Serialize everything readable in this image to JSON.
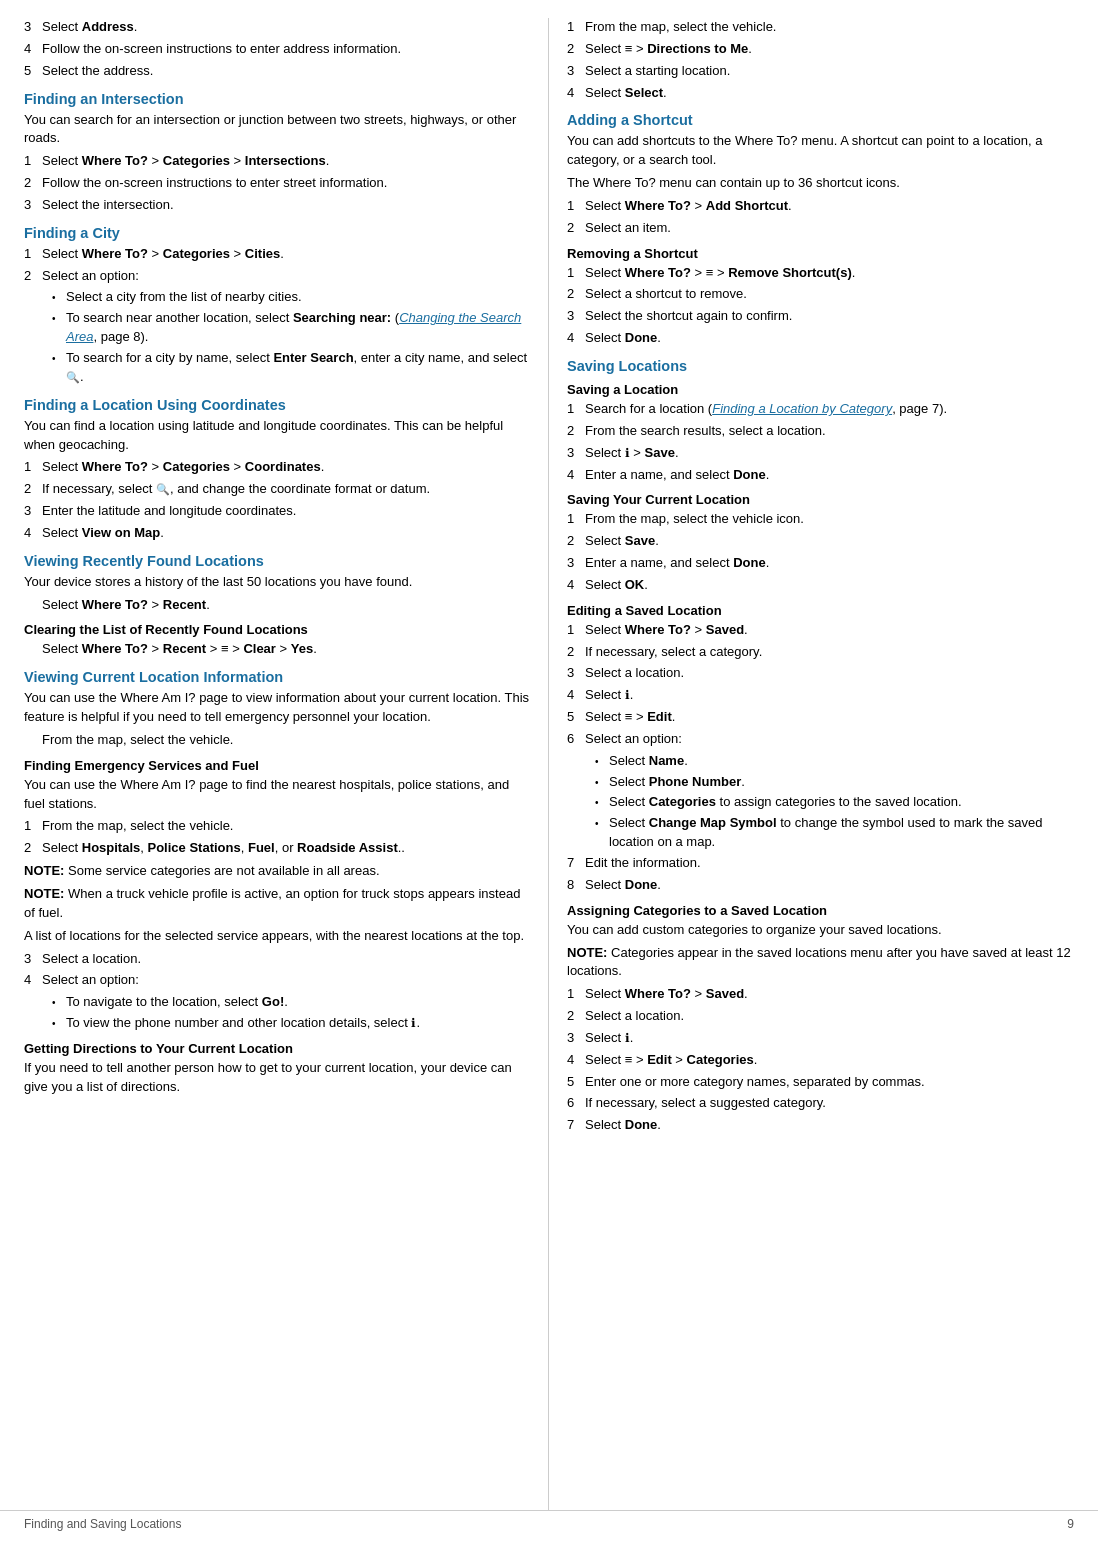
{
  "footer": {
    "left": "Finding and Saving Locations",
    "right": "9"
  },
  "left_column": {
    "sections": [
      {
        "id": "finding-intersection",
        "type": "section",
        "heading": null,
        "pre_steps": [
          {
            "type": "step",
            "num": "3",
            "text": "Select <b>Address</b>."
          },
          {
            "type": "step",
            "num": "4",
            "text": "Follow the on-screen instructions to enter address information."
          },
          {
            "type": "step",
            "num": "5",
            "text": "Select the address."
          }
        ]
      },
      {
        "id": "finding-intersection-section",
        "type": "heading-section",
        "heading": "Finding an Intersection",
        "heading_color": "blue",
        "intro": "You can search for an intersection or junction between two streets, highways, or other roads.",
        "steps": [
          {
            "num": "1",
            "text": "Select <b>Where To?</b> > <b>Categories</b> > <b>Intersections</b>."
          },
          {
            "num": "2",
            "text": "Follow the on-screen instructions to enter street information."
          },
          {
            "num": "3",
            "text": "Select the intersection."
          }
        ]
      },
      {
        "id": "finding-city",
        "type": "heading-section",
        "heading": "Finding a City",
        "heading_color": "blue",
        "intro": null,
        "steps": [
          {
            "num": "1",
            "text": "Select <b>Where To?</b> > <b>Categories</b> > <b>Cities</b>."
          },
          {
            "num": "2",
            "text": "Select an option:"
          }
        ],
        "bullets": [
          "Select a city from the list of nearby cities.",
          "To search near another location, select <b>Searching near:</b> (<span class=\"blue-link\">Changing the Search Area</span>, page 8).",
          "To search for a city by name, select <b>Enter Search</b>, enter a city name, and select <span class=\"search-icon-small\"></span>."
        ]
      },
      {
        "id": "finding-coordinates",
        "type": "heading-section",
        "heading": "Finding a Location Using Coordinates",
        "heading_color": "blue",
        "intro": "You can find a location using latitude and longitude coordinates. This can be helpful when geocaching.",
        "steps": [
          {
            "num": "1",
            "text": "Select <b>Where To?</b> > <b>Categories</b> > <b>Coordinates</b>."
          },
          {
            "num": "2",
            "text": "If necessary, select <span class=\"search-icon-small\"></span>, and change the coordinate format or datum."
          },
          {
            "num": "3",
            "text": "Enter the latitude and longitude coordinates."
          },
          {
            "num": "4",
            "text": "Select <b>View on Map</b>."
          }
        ]
      },
      {
        "id": "viewing-recently",
        "type": "heading-section",
        "heading": "Viewing Recently Found Locations",
        "heading_color": "blue",
        "intro": "Your device stores a history of the last 50 locations you have found.",
        "indent": "Select <b>Where To?</b> > <b>Recent</b>.",
        "sub_sections": [
          {
            "sub_heading": "Clearing the List of Recently Found Locations",
            "indent": "Select <b>Where To?</b> > <b>Recent</b> > <span class=\"menu-icon\"></span> > <b>Clear</b> > <b>Yes</b>."
          }
        ]
      },
      {
        "id": "viewing-current",
        "type": "heading-section",
        "heading": "Viewing Current Location Information",
        "heading_color": "blue",
        "intro": "You can use the Where Am I? page to view information about your current location. This feature is helpful if you need to tell emergency personnel your location.",
        "indent": "From the map, select the vehicle.",
        "sub_sections": [
          {
            "sub_heading": "Finding Emergency Services and Fuel",
            "intro": "You can use the Where Am I? page to find the nearest hospitals, police stations, and fuel stations.",
            "steps": [
              {
                "num": "1",
                "text": "From the map, select the vehicle."
              },
              {
                "num": "2",
                "text": "Select <b>Hospitals</b>, <b>Police Stations</b>, <b>Fuel</b>, or <b>Roadside Assist</b>.."
              }
            ],
            "notes": [
              "NOTE: Some service categories are not available in all areas.",
              "NOTE: When a truck vehicle profile is active, an option for truck stops appears instead of fuel."
            ],
            "after_notes": "A list of locations for the selected service appears, with the nearest locations at the top.",
            "more_steps": [
              {
                "num": "3",
                "text": "Select a location."
              },
              {
                "num": "4",
                "text": "Select an option:"
              }
            ],
            "bullets": [
              "To navigate to the location, select <b>Go!</b>.",
              "To view the phone number and other location details, select <span class=\"info-icon\"></span>."
            ]
          },
          {
            "sub_heading": "Getting Directions to Your Current Location",
            "intro": "If you need to tell another person how to get to your current location, your device can give you a list of directions."
          }
        ]
      }
    ]
  },
  "right_column": {
    "sections": [
      {
        "id": "directions-to-me",
        "type": "steps-only",
        "steps": [
          {
            "num": "1",
            "text": "From the map, select the vehicle."
          },
          {
            "num": "2",
            "text": "Select <span class=\"menu-icon\"></span> > <b>Directions to Me</b>."
          },
          {
            "num": "3",
            "text": "Select a starting location."
          },
          {
            "num": "4",
            "text": "Select <b>Select</b>."
          }
        ]
      },
      {
        "id": "adding-shortcut",
        "type": "heading-section",
        "heading": "Adding a Shortcut",
        "heading_color": "blue",
        "intro": "You can add shortcuts to the Where To? menu. A shortcut can point to a location, a category, or a search tool.",
        "intro2": "The Where To? menu can contain up to 36 shortcut icons.",
        "steps": [
          {
            "num": "1",
            "text": "Select <b>Where To?</b> > <b>Add Shortcut</b>."
          },
          {
            "num": "2",
            "text": "Select an item."
          }
        ],
        "sub_sections": [
          {
            "sub_heading": "Removing a Shortcut",
            "steps": [
              {
                "num": "1",
                "text": "Select <b>Where To?</b> > <span class=\"menu-icon\"></span> > <b>Remove Shortcut(s)</b>."
              },
              {
                "num": "2",
                "text": "Select a shortcut to remove."
              },
              {
                "num": "3",
                "text": "Select the shortcut again to confirm."
              },
              {
                "num": "4",
                "text": "Select <b>Done</b>."
              }
            ]
          }
        ]
      },
      {
        "id": "saving-locations",
        "type": "heading-section",
        "heading": "Saving Locations",
        "heading_color": "blue",
        "sub_sections": [
          {
            "sub_heading": "Saving a Location",
            "steps": [
              {
                "num": "1",
                "text": "Search for a location (<span class=\"blue-link\">Finding a Location by Category</span>, page 7)."
              },
              {
                "num": "2",
                "text": "From the search results, select a location."
              },
              {
                "num": "3",
                "text": "Select <span class=\"info-icon\"></span> > <b>Save</b>."
              },
              {
                "num": "4",
                "text": "Enter a name, and select <b>Done</b>."
              }
            ]
          },
          {
            "sub_heading": "Saving Your Current Location",
            "steps": [
              {
                "num": "1",
                "text": "From the map, select the vehicle icon."
              },
              {
                "num": "2",
                "text": "Select <b>Save</b>."
              },
              {
                "num": "3",
                "text": "Enter a name, and select <b>Done</b>."
              },
              {
                "num": "4",
                "text": "Select <b>OK</b>."
              }
            ]
          },
          {
            "sub_heading": "Editing a Saved Location",
            "steps": [
              {
                "num": "1",
                "text": "Select <b>Where To?</b> > <b>Saved</b>."
              },
              {
                "num": "2",
                "text": "If necessary, select a category."
              },
              {
                "num": "3",
                "text": "Select a location."
              },
              {
                "num": "4",
                "text": "Select <span class=\"info-icon\"></span>."
              },
              {
                "num": "5",
                "text": "Select <span class=\"menu-icon\"></span> > <b>Edit</b>."
              },
              {
                "num": "6",
                "text": "Select an option:"
              }
            ],
            "bullets": [
              "Select <b>Name</b>.",
              "Select <b>Phone Number</b>.",
              "Select <b>Categories</b> to assign categories to the saved location.",
              "Select <b>Change Map Symbol</b> to change the symbol used to mark the saved location on a map."
            ],
            "more_steps": [
              {
                "num": "7",
                "text": "Edit the information."
              },
              {
                "num": "8",
                "text": "Select <b>Done</b>."
              }
            ]
          },
          {
            "sub_heading": "Assigning Categories to a Saved Location",
            "intro": "You can add custom categories to organize your saved locations.",
            "note": "NOTE: Categories appear in the saved locations menu after you have saved at least 12 locations.",
            "steps": [
              {
                "num": "1",
                "text": "Select <b>Where To?</b> > <b>Saved</b>."
              },
              {
                "num": "2",
                "text": "Select a location."
              },
              {
                "num": "3",
                "text": "Select <span class=\"info-icon\"></span>."
              },
              {
                "num": "4",
                "text": "Select <span class=\"menu-icon\"></span> > <b>Edit</b> > <b>Categories</b>."
              },
              {
                "num": "5",
                "text": "Enter one or more category names, separated by commas."
              },
              {
                "num": "6",
                "text": "If necessary, select a suggested category."
              },
              {
                "num": "7",
                "text": "Select <b>Done</b>."
              }
            ]
          }
        ]
      }
    ]
  }
}
